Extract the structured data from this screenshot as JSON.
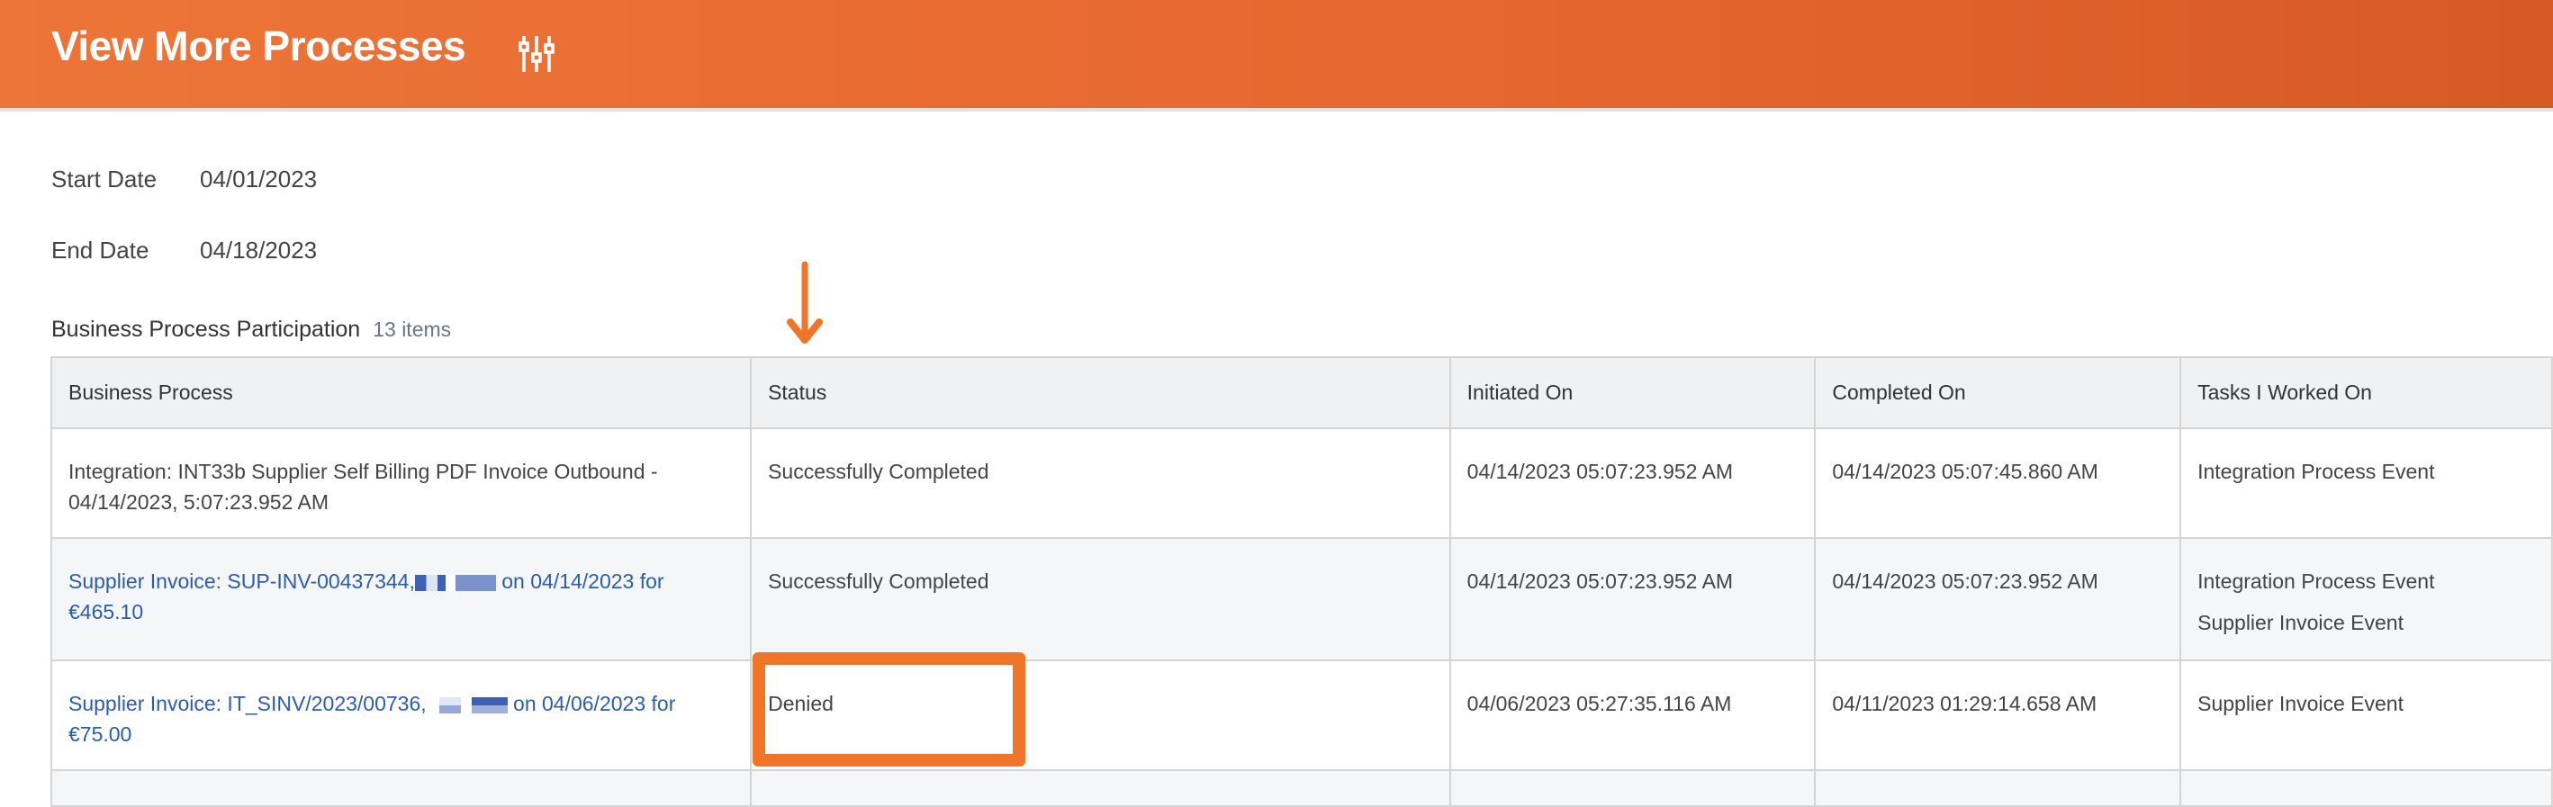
{
  "header": {
    "title": "View More Processes",
    "icon": "filter-sliders-icon",
    "color": "#ea6d33"
  },
  "filters": {
    "start_label": "Start Date",
    "start_value": "04/01/2023",
    "end_label": "End Date",
    "end_value": "04/18/2023"
  },
  "section": {
    "title": "Business Process Participation",
    "count": "13 items"
  },
  "table": {
    "columns": [
      "Business Process",
      "Status",
      "Initiated On",
      "Completed On",
      "Tasks I Worked On"
    ],
    "rows": [
      {
        "process": "Integration: INT33b Supplier Self Billing PDF Invoice Outbound - 04/14/2023, 5:07:23.952 AM",
        "status": "Successfully Completed",
        "initiated": "04/14/2023 05:07:23.952 AM",
        "completed": "04/14/2023 05:07:45.860 AM",
        "tasks": [
          "Integration Process Event"
        ]
      },
      {
        "process_prefix": "Supplier Invoice: SUP-INV-00437344,",
        "process_suffix": " on 04/14/2023 for €465.10",
        "status": "Successfully Completed",
        "initiated": "04/14/2023 05:07:23.952 AM",
        "completed": "04/14/2023 05:07:23.952 AM",
        "tasks": [
          "Integration Process Event",
          "Supplier Invoice Event"
        ]
      },
      {
        "process_prefix": "Supplier Invoice: IT_SINV/2023/00736,",
        "process_suffix": " on 04/06/2023 for €75.00",
        "status": "Denied",
        "initiated": "04/06/2023 05:27:35.116 AM",
        "completed": "04/11/2023 01:29:14.658 AM",
        "tasks": [
          "Supplier Invoice Event"
        ]
      }
    ]
  },
  "annotation": {
    "color": "#f07528",
    "highlighted_status": "Denied"
  }
}
